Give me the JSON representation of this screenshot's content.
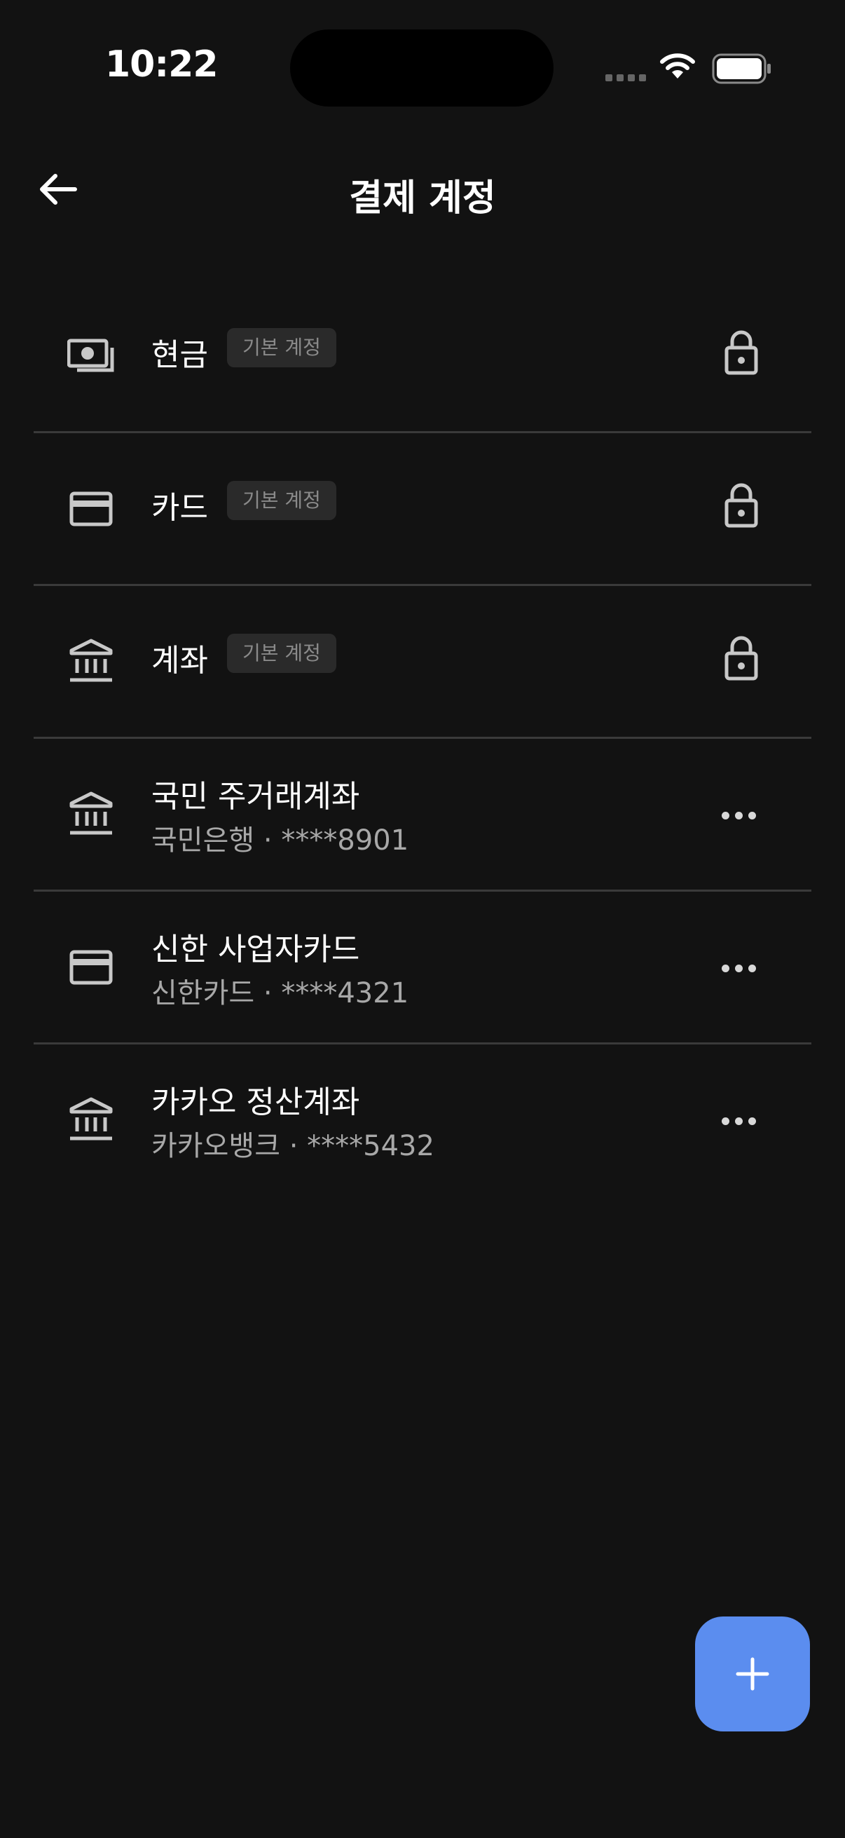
{
  "status_bar": {
    "time": "10:22"
  },
  "header": {
    "title": "결제 계정",
    "back_icon": "arrow-left-icon"
  },
  "accounts": [
    {
      "name": "현금",
      "badge": "기본 계정",
      "icon": "cash-icon",
      "locked": true
    },
    {
      "name": "카드",
      "badge": "기본 계정",
      "icon": "card-icon",
      "locked": true
    },
    {
      "name": "계좌",
      "badge": "기본 계정",
      "icon": "bank-icon",
      "locked": true
    },
    {
      "name": "국민 주거래계좌",
      "subtitle": "국민은행 · ****8901",
      "icon": "bank-icon"
    },
    {
      "name": "신한 사업자카드",
      "subtitle": "신한카드 · ****4321",
      "icon": "card-icon"
    },
    {
      "name": "카카오 정산계좌",
      "subtitle": "카카오뱅크 · ****5432",
      "icon": "bank-icon"
    }
  ],
  "fab": {
    "icon": "plus-icon"
  },
  "colors": {
    "background": "#121212",
    "accent": "#5b8def",
    "divider": "#3a3a3a",
    "secondary_text": "#a8a8a8"
  }
}
